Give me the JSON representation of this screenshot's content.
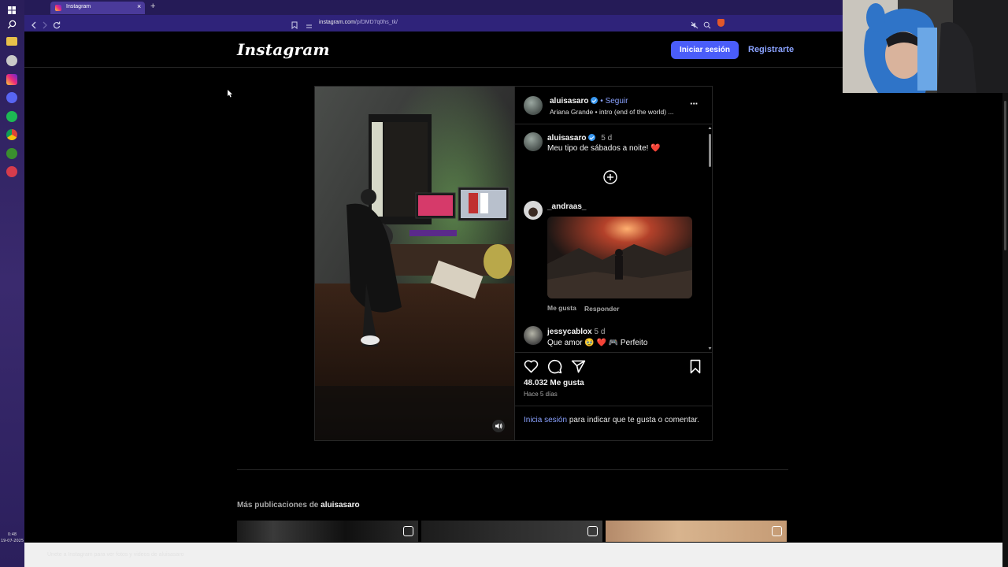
{
  "browser": {
    "tab_title": "Instagram",
    "tab_close": "×",
    "new_tab": "+",
    "url_host": "instagram.com",
    "url_path": "/p/DMD7q0hs_tk/"
  },
  "taskbar": {
    "time": "0:48",
    "date": "19-07-2025"
  },
  "header": {
    "logo": "Instagram",
    "login_label": "Iniciar sesión",
    "register_label": "Registrarte"
  },
  "post": {
    "username": "aluisasaro",
    "follow_label": "Seguir",
    "follow_sep": "•",
    "audio": "Ariana Grande • intro (end of the world) ...",
    "more_label": "···",
    "caption_user": "aluisasaro",
    "caption_time": "5 d",
    "caption_text": "Meu tipo de sábados a noite! ❤️",
    "comments": [
      {
        "user": "_andraas_",
        "like_label": "Me gusta",
        "reply_label": "Responder"
      },
      {
        "user": "jessycablox",
        "time": "5 d",
        "text": "Que amor 🥹 ❤️ 🎮 Perfeito"
      }
    ],
    "likes": "48.032 Me gusta",
    "posted": "Hace 5 días",
    "login_prompt_link": "Inicia sesión",
    "login_prompt_text": "para indicar que te gusta o comentar."
  },
  "more_posts": {
    "title_prefix": "Más publicaciones de",
    "title_user": "aluisasaro"
  },
  "bottom_bar": {
    "text": "Únete a Instagram para ver fotos y videos de aluisasaro"
  },
  "colors": {
    "accent_blue": "#4a5df9",
    "link_blue": "#8aa2ff",
    "verified_blue": "#3897f0",
    "heart_red": "#ed4956",
    "browser_purple": "#2f237a"
  },
  "icons": [
    "windows-start-icon",
    "search-icon",
    "files-icon",
    "shield-icon",
    "instagram-icon",
    "discord-icon",
    "spotify-icon",
    "chrome-icon",
    "xbox-icon",
    "app-icon",
    "heart-icon",
    "comment-icon",
    "share-icon",
    "bookmark-icon",
    "volume-icon",
    "plus-circle-icon",
    "reel-icon"
  ]
}
